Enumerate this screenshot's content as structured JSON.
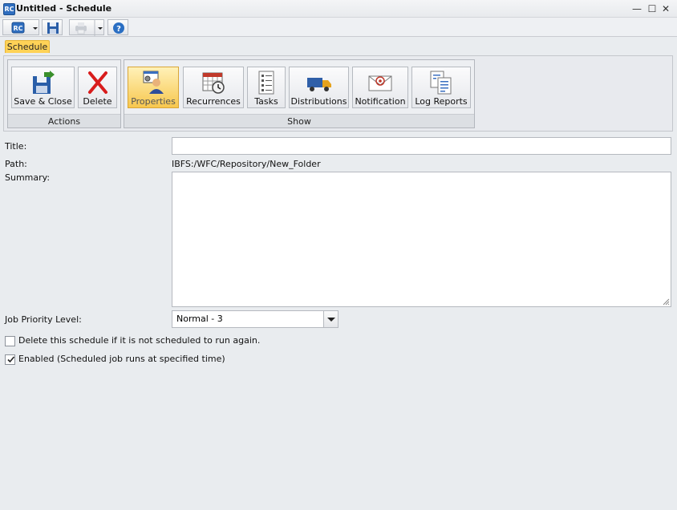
{
  "window": {
    "app_icon_text": "RC",
    "title": "Untitled - Schedule",
    "minimize_glyph": "—",
    "maximize_glyph": "☐",
    "close_glyph": "✕"
  },
  "quick_access": {
    "buttons": [
      {
        "icon": "rc-menu-icon"
      },
      {
        "icon": "save-icon"
      },
      {
        "icon": "print-icon"
      },
      {
        "icon": "help-icon"
      }
    ]
  },
  "tabs": [
    {
      "label": "Schedule",
      "active": true
    }
  ],
  "ribbon": {
    "groups": [
      {
        "label": "Actions",
        "buttons": [
          {
            "label": "Save & Close",
            "icon": "save-close-icon"
          },
          {
            "label": "Delete",
            "icon": "delete-x-icon"
          }
        ]
      },
      {
        "label": "Show",
        "buttons": [
          {
            "label": "Properties",
            "icon": "properties-icon",
            "active": true
          },
          {
            "label": "Recurrences",
            "icon": "calendar-clock-icon"
          },
          {
            "label": "Tasks",
            "icon": "task-list-icon"
          },
          {
            "label": "Distributions",
            "icon": "delivery-truck-icon"
          },
          {
            "label": "Notification",
            "icon": "email-icon"
          },
          {
            "label": "Log Reports",
            "icon": "log-report-icon"
          }
        ]
      }
    ]
  },
  "form": {
    "title_label": "Title:",
    "title_value": "",
    "path_label": "Path:",
    "path_value": "IBFS:/WFC/Repository/New_Folder",
    "summary_label": "Summary:",
    "summary_value": "",
    "priority_label": "Job Priority Level:",
    "priority_value": "Normal - 3",
    "delete_checkbox_label": "Delete this schedule if it is not scheduled to run again.",
    "delete_checked": false,
    "enabled_checkbox_label": "Enabled (Scheduled job runs at specified time)",
    "enabled_checked": true
  },
  "colors": {
    "active_tab": "#ffd257",
    "active_button": "#f7c74e",
    "background": "#e9ecef",
    "delete_red": "#d81c1c",
    "help_blue": "#2b6fc3"
  }
}
